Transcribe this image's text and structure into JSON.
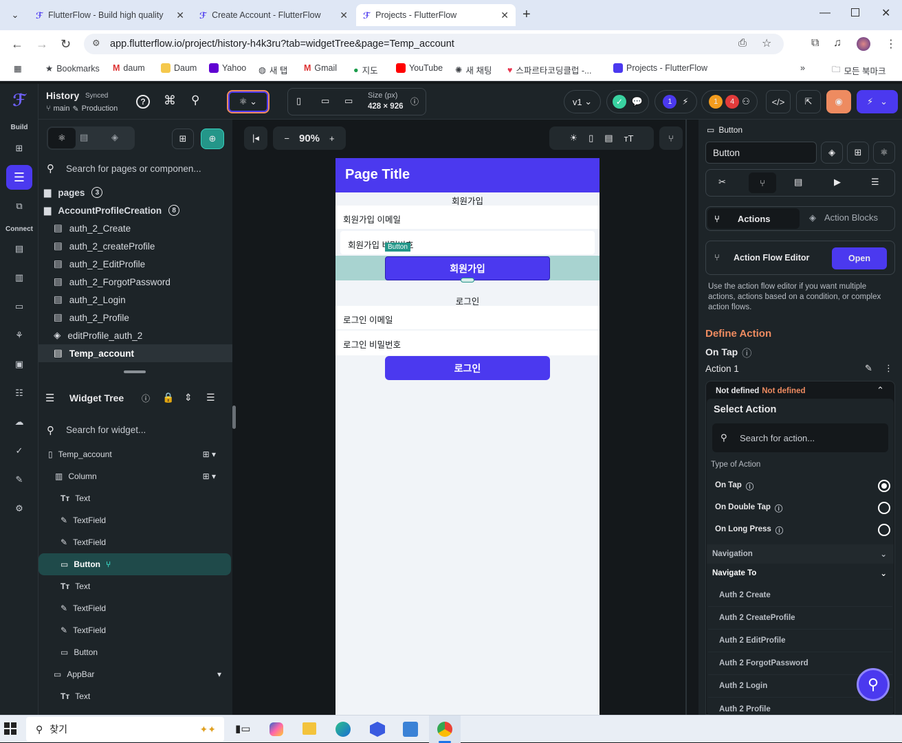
{
  "browser": {
    "tabs": [
      {
        "title": "FlutterFlow - Build high quality"
      },
      {
        "title": "Create Account - FlutterFlow"
      },
      {
        "title": "Projects - FlutterFlow"
      }
    ],
    "url": "app.flutterflow.io/project/history-h4k3ru?tab=widgetTree&page=Temp_account",
    "bookmarks": [
      "Bookmarks",
      "daum",
      "Daum",
      "Yahoo",
      "새 탭",
      "Gmail",
      "지도",
      "YouTube",
      "새 채팅",
      "스파르타코딩클럽 -...",
      "Projects - FlutterFlow"
    ],
    "bookmarks_folder": "모든 북마크"
  },
  "rail": {
    "build_label": "Build",
    "connect_label": "Connect"
  },
  "project": {
    "name": "History",
    "status": "Synced",
    "branch": "main",
    "env": "Production"
  },
  "toolbar": {
    "size_label": "Size (px)",
    "size_value": "428 × 926",
    "version": "v1",
    "badge_blue": "1",
    "badge_orange": "1",
    "badge_red": "4",
    "zoom": "90%"
  },
  "left": {
    "search_placeholder": "Search for pages or componen...",
    "pages_label": "pages",
    "pages_count": "3",
    "folder_label": "AccountProfileCreation",
    "folder_count": "8",
    "pages": [
      "auth_2_Create",
      "auth_2_createProfile",
      "auth_2_EditProfile",
      "auth_2_ForgotPassword",
      "auth_2_Login",
      "auth_2_Profile",
      "editProfile_auth_2",
      "Temp_account"
    ],
    "widget_tree_label": "Widget Tree",
    "widget_search_placeholder": "Search for widget...",
    "tree": [
      "Temp_account",
      "Column",
      "Text",
      "TextField",
      "TextField",
      "Button",
      "Text",
      "TextField",
      "TextField",
      "Button",
      "AppBar",
      "Text"
    ]
  },
  "phone": {
    "page_title": "Page Title",
    "signup_header": "회원가입",
    "signup_email": "회원가입 이메일",
    "signup_password": "회원가입 비밀번호",
    "button_tag": "Button",
    "signup_button": "회원가입",
    "login_header": "로그인",
    "login_email": "로그인 이메일",
    "login_password": "로그인 비밀번호",
    "login_button": "로그인"
  },
  "right": {
    "selected_type": "Button",
    "name_value": "Button",
    "tab_actions": "Actions",
    "tab_action_blocks": "Action Blocks",
    "afe_label": "Action Flow Editor",
    "afe_open": "Open",
    "afe_desc": "Use the action flow editor if you want multiple actions, actions based on a condition, or complex action flows.",
    "define_action": "Define Action",
    "on_tap": "On Tap",
    "action1": "Action 1",
    "not_defined_a": "Not defined",
    "not_defined_b": "Not defined",
    "select_action": "Select Action",
    "search_action_placeholder": "Search for action...",
    "type_of_action": "Type of Action",
    "types": [
      "On Tap",
      "On Double Tap",
      "On Long Press"
    ],
    "navigation": "Navigation",
    "navigate_to": "Navigate To",
    "nav_items": [
      "Auth 2 Create",
      "Auth 2 CreateProfile",
      "Auth 2 EditProfile",
      "Auth 2 ForgotPassword",
      "Auth 2 Login",
      "Auth 2 Profile"
    ]
  },
  "taskbar": {
    "search": "찾기"
  },
  "colors": {
    "accent": "#4b39ef",
    "orange": "#ee8b60",
    "teal": "#249689"
  }
}
